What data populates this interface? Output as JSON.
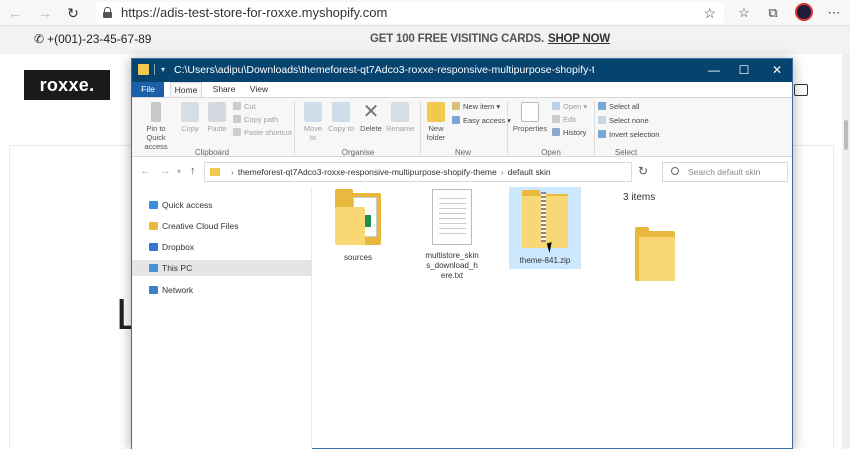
{
  "browser": {
    "url": "https://adis-test-store-for-roxxe.myshopify.com",
    "back_glyph": "←",
    "forward_glyph": "→",
    "refresh_glyph": "↻",
    "favorite_glyph": "☆",
    "collections_glyph": "☆",
    "tabs_glyph": "⧉",
    "more_glyph": "⋯"
  },
  "store": {
    "phone": "+(001)-23-45-67-89",
    "promo_text": "GET 100 FREE VISITING CARDS.",
    "promo_link": "SHOP NOW",
    "logo": "roxxe.",
    "hero_letter": "L"
  },
  "explorer": {
    "title": "C:\\Users\\adipu\\Downloads\\themeforest-qt7Adco3-roxxe-responsive-multipurpose-shopify-theme\\defau",
    "window_controls": {
      "minimize": "—",
      "maximize": "☐",
      "close": "✕"
    },
    "tabs": [
      {
        "label": "File"
      },
      {
        "label": "Home"
      },
      {
        "label": "Share"
      },
      {
        "label": "View"
      }
    ],
    "ribbon": {
      "clipboard": {
        "pin": "Pin to Quick access",
        "copy": "Copy",
        "paste": "Paste",
        "cut": "Cut",
        "copy_path": "Copy path",
        "paste_shortcut": "Paste shortcut",
        "label": "Clipboard"
      },
      "organise": {
        "move_to": "Move to",
        "copy_to": "Copy to",
        "delete": "Delete",
        "rename": "Rename",
        "label": "Organise"
      },
      "new": {
        "new_folder": "New folder",
        "new_item": "New item ▾",
        "easy_access": "Easy access ▾",
        "label": "New"
      },
      "open": {
        "properties": "Properties",
        "open": "Open ▾",
        "edit": "Edit",
        "history": "History",
        "label": "Open"
      },
      "select": {
        "select_all": "Select all",
        "select_none": "Select none",
        "invert_selection": "Invert selection",
        "label": "Select"
      }
    },
    "path": {
      "segments": [
        "themeforest-qt7Adco3-roxxe-responsive-multipurpose-shopify-theme",
        "default skin"
      ],
      "separator": "›"
    },
    "search_placeholder": "Search default skin",
    "nav": [
      {
        "label": "Quick access",
        "color": "#3b8ee0"
      },
      {
        "label": "Creative Cloud Files",
        "color": "#e8b93e"
      },
      {
        "label": "Dropbox",
        "color": "#2f78d8"
      },
      {
        "label": "This PC",
        "color": "#4a90d9"
      },
      {
        "label": "Network",
        "color": "#3d7fc4"
      }
    ],
    "files": [
      {
        "name": "sources"
      },
      {
        "name": "multistore_skins_download_here.txt"
      },
      {
        "name": "theme-841.zip"
      }
    ],
    "items_count": "3 items"
  }
}
